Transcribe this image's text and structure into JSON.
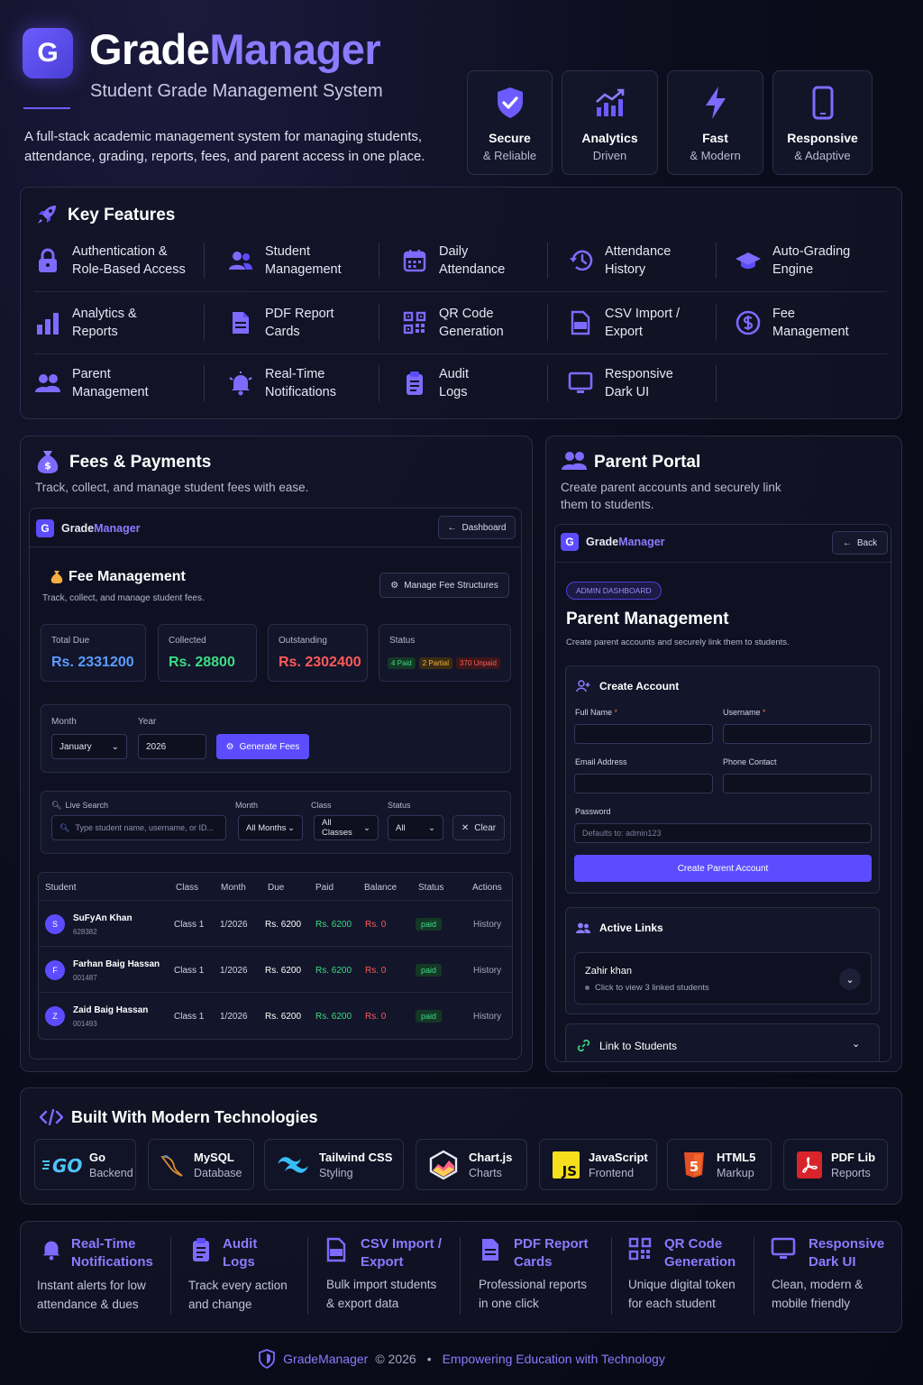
{
  "header": {
    "logo_letter": "G",
    "brand_part1": "Grade",
    "brand_part2": "Manager",
    "tagline": "Student Grade Management System",
    "intro": "A full-stack academic management system for managing students, attendance, grading, reports, fees, and parent access in one place.",
    "badges": [
      {
        "title": "Secure",
        "subtitle": "& Reliable",
        "icon": "shield-check-icon"
      },
      {
        "title": "Analytics",
        "subtitle": "Driven",
        "icon": "chart-up-icon"
      },
      {
        "title": "Fast",
        "subtitle": "& Modern",
        "icon": "bolt-icon"
      },
      {
        "title": "Responsive",
        "subtitle": "& Adaptive",
        "icon": "phone-icon"
      }
    ]
  },
  "key_features": {
    "title": "Key Features",
    "items": [
      "Authentication &\nRole-Based Access",
      "Student\nManagement",
      "Daily\nAttendance",
      "Attendance\nHistory",
      "Auto-Grading\nEngine",
      "Analytics &\nReports",
      "PDF Report\nCards",
      "QR Code\nGeneration",
      "CSV Import /\nExport",
      "Fee\nManagement",
      "Parent\nManagement",
      "Real-Time\nNotifications",
      "Audit\nLogs",
      "Responsive\nDark UI"
    ]
  },
  "fees": {
    "title": "Fees & Payments",
    "subtitle": "Track, collect, and manage student fees with ease.",
    "app": {
      "brand1": "Grade",
      "brand2": "Manager",
      "logo": "G",
      "dashboard_btn": "Dashboard",
      "heading": "Fee Management",
      "desc": "Track, collect, and manage student fees.",
      "manage_btn": "Manage Fee Structures",
      "stats": [
        {
          "label": "Total Due",
          "value": "Rs. 2331200",
          "color": "#5b9dff"
        },
        {
          "label": "Collected",
          "value": "Rs. 28800",
          "color": "#3ddc84"
        },
        {
          "label": "Outstanding",
          "value": "Rs. 2302400",
          "color": "#ff5a5a"
        }
      ],
      "status_label": "Status",
      "status_pills": [
        "4 Paid",
        "2 Partial",
        "370 Unpaid"
      ],
      "month_label": "Month",
      "month_value": "January",
      "year_label": "Year",
      "year_value": "2026",
      "generate_btn": "Generate Fees",
      "search_label": "Live Search",
      "search_placeholder": "Type student name, username, or ID...",
      "filter_month_label": "Month",
      "filter_month": "All Months",
      "filter_class_label": "Class",
      "filter_class": "All Classes",
      "filter_status_label": "Status",
      "filter_status": "All",
      "clear_btn": "Clear",
      "columns": [
        "Student",
        "Class",
        "Month",
        "Due",
        "Paid",
        "Balance",
        "Status",
        "Actions"
      ],
      "rows": [
        {
          "initial": "S",
          "name": "SuFyAn Khan",
          "id": "628382",
          "class": "Class 1",
          "month": "1/2026",
          "due": "Rs. 6200",
          "paid": "Rs. 6200",
          "balance": "Rs. 0",
          "status": "paid",
          "action": "History"
        },
        {
          "initial": "F",
          "name": "Farhan Baig Hassan",
          "id": "001487",
          "class": "Class 1",
          "month": "1/2026",
          "due": "Rs. 6200",
          "paid": "Rs. 6200",
          "balance": "Rs. 0",
          "status": "paid",
          "action": "History"
        },
        {
          "initial": "Z",
          "name": "Zaid Baig Hassan",
          "id": "001493",
          "class": "Class 1",
          "month": "1/2026",
          "due": "Rs. 6200",
          "paid": "Rs. 6200",
          "balance": "Rs. 0",
          "status": "paid",
          "action": "History"
        }
      ]
    }
  },
  "parent": {
    "title": "Parent Portal",
    "subtitle": "Create parent accounts and securely link them to students.",
    "app": {
      "brand1": "Grade",
      "brand2": "Manager",
      "logo": "G",
      "back_btn": "Back",
      "badge": "ADMIN DASHBOARD",
      "heading": "Parent Management",
      "desc": "Create parent accounts and securely link them to students.",
      "create_title": "Create Account",
      "full_name": "Full Name",
      "username": "Username",
      "email": "Email Address",
      "phone": "Phone Contact",
      "password": "Password",
      "password_placeholder": "Defaults to: admin123",
      "create_btn": "Create Parent Account",
      "active_title": "Active Links",
      "link_name": "Zahir khan",
      "link_sub": "Click to view 3 linked students",
      "link_students": "Link to Students"
    }
  },
  "tech": {
    "title": "Built With Modern Technologies",
    "items": [
      {
        "name": "Go",
        "sub": "Backend"
      },
      {
        "name": "MySQL",
        "sub": "Database"
      },
      {
        "name": "Tailwind CSS",
        "sub": "Styling"
      },
      {
        "name": "Chart.js",
        "sub": "Charts"
      },
      {
        "name": "JavaScript",
        "sub": "Frontend"
      },
      {
        "name": "HTML5",
        "sub": "Markup"
      },
      {
        "name": "PDF Lib",
        "sub": "Reports"
      }
    ]
  },
  "highlights": [
    {
      "title": "Real-Time\nNotifications",
      "sub": "Instant alerts for low\nattendance & dues"
    },
    {
      "title": "Audit\nLogs",
      "sub": "Track every action\nand change"
    },
    {
      "title": "CSV Import /\nExport",
      "sub": "Bulk import students\n& export data"
    },
    {
      "title": "PDF Report\nCards",
      "sub": "Professional reports\nin one click"
    },
    {
      "title": "QR Code\nGeneration",
      "sub": "Unique digital token\nfor each student"
    },
    {
      "title": "Responsive\nDark UI",
      "sub": "Clean, modern &\nmobile friendly"
    }
  ],
  "footer": {
    "brand": "GradeManager",
    "year": "© 2026",
    "dot": "•",
    "slogan": "Empowering Education with Technology"
  },
  "colors": {
    "accent": "#6c5cff",
    "accent_light": "#8b7bff",
    "paid": "#3ddc84",
    "unpaid": "#ff5a5a",
    "partial": "#f5b041"
  }
}
